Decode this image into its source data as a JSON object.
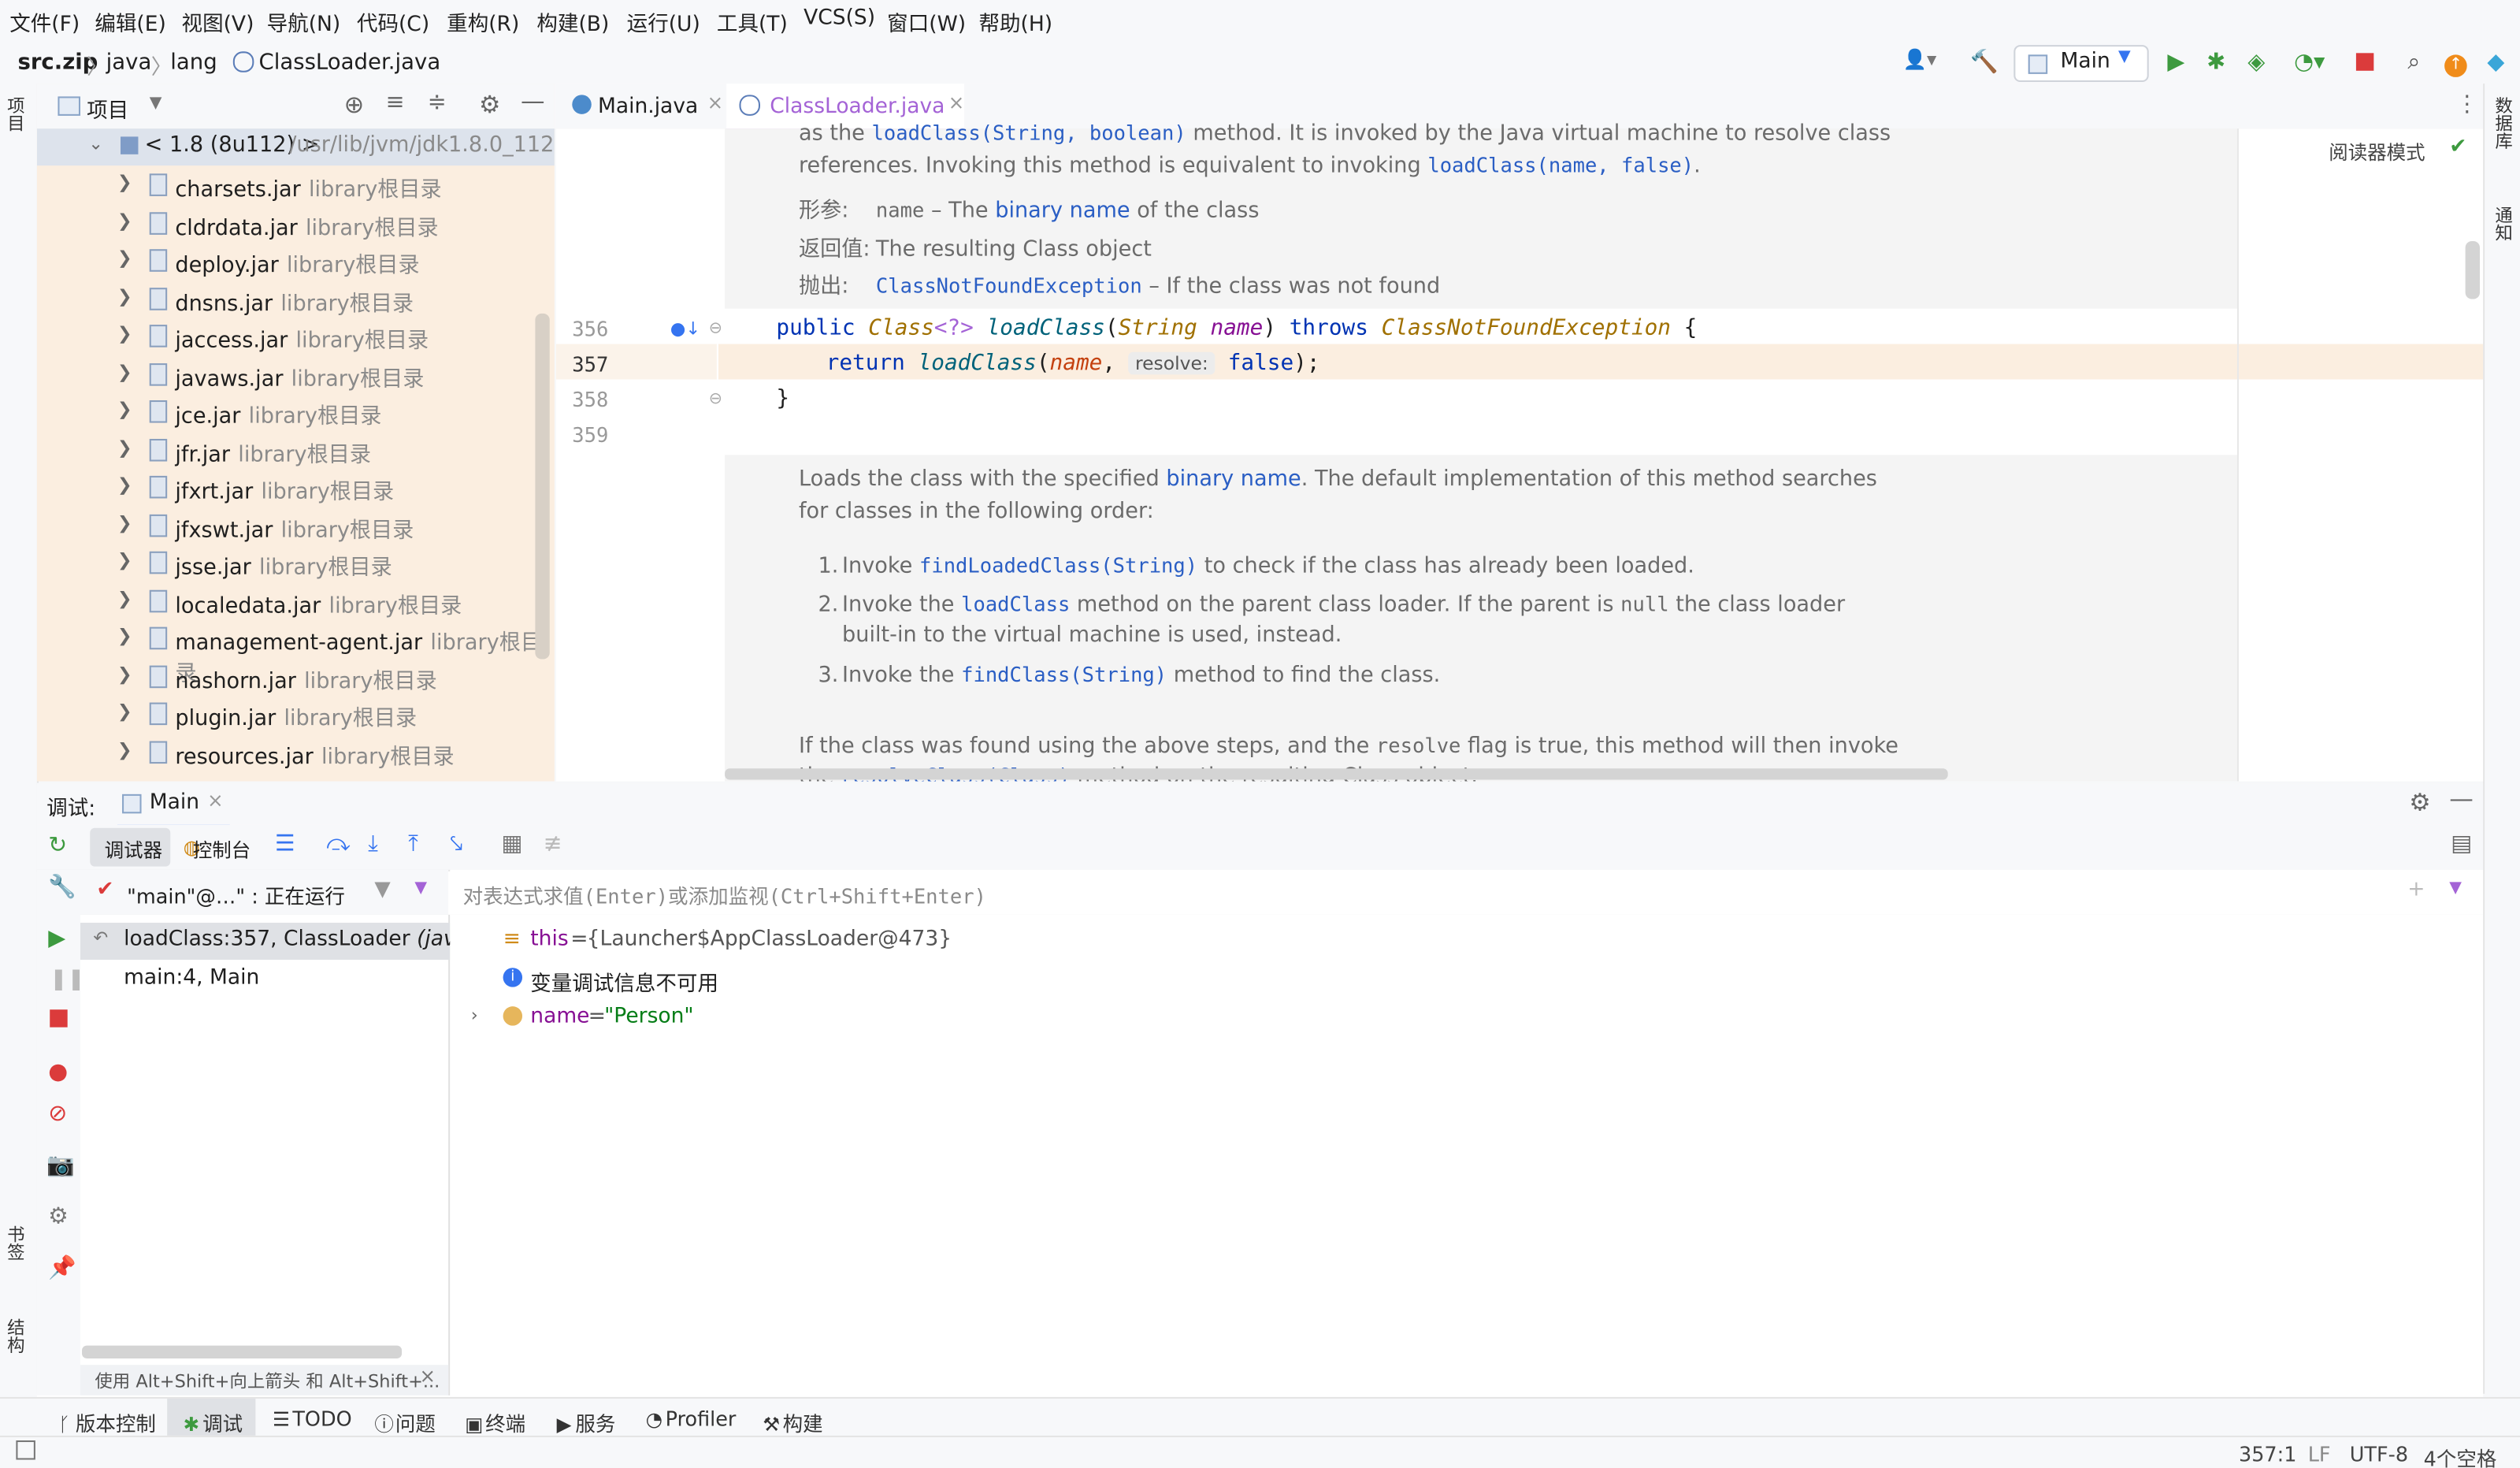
{
  "menu": [
    "文件(F)",
    "编辑(E)",
    "视图(V)",
    "导航(N)",
    "代码(C)",
    "重构(R)",
    "构建(B)",
    "运行(U)",
    "工具(T)",
    "VCS(S)",
    "窗口(W)",
    "帮助(H)"
  ],
  "breadcrumb": [
    "src.zip",
    "java",
    "lang",
    "ClassLoader.java"
  ],
  "run_config": "Main",
  "left_toolwindows": {
    "project": "项目",
    "bookmarks": "书签",
    "structure": "结构"
  },
  "right_toolwindows": {
    "database": "数据库",
    "notifications": "通知"
  },
  "project_panel": {
    "title": "项目",
    "root": {
      "label": "< 1.8 (8u112) >",
      "path": "/usr/lib/jvm/jdk1.8.0_112"
    },
    "library_suffix": "library根目录",
    "items": [
      "charsets.jar",
      "cldrdata.jar",
      "deploy.jar",
      "dnsns.jar",
      "jaccess.jar",
      "javaws.jar",
      "jce.jar",
      "jfr.jar",
      "jfxrt.jar",
      "jfxswt.jar",
      "jsse.jar",
      "localedata.jar",
      "management-agent.jar",
      "nashorn.jar",
      "plugin.jar",
      "resources.jar"
    ]
  },
  "editor": {
    "tabs": [
      {
        "label": "Main.java",
        "active": false
      },
      {
        "label": "ClassLoader.java",
        "active": true
      }
    ],
    "reader_mode": "阅读器模式",
    "doc_top": {
      "line1_pre": "as the ",
      "line1_code": "loadClass(String, boolean)",
      "line1_post": " method. It is invoked by the Java virtual machine to resolve class",
      "line2_pre": "references. Invoking this method is equivalent to invoking ",
      "line2_code": "loadClass(name, false)",
      "line2_post": ".",
      "param_label": "形参:",
      "param_name": "name",
      "param_dash": " – The ",
      "param_link": "binary name",
      "param_post": " of the class",
      "return_label": "返回值:",
      "return_text": "The resulting Class object",
      "throws_label": "抛出:",
      "throws_code": "ClassNotFoundException",
      "throws_post": " – If the class was not found"
    },
    "line_numbers": [
      "356",
      "357",
      "358",
      "359"
    ],
    "code": {
      "l356": {
        "kw1": "public ",
        "ty1": "Class",
        "ty2": "<?> ",
        "fn": "loadClass",
        "p1": "(",
        "ty3": "String ",
        "nm": "name",
        "p2": ") ",
        "kw2": "throws ",
        "ty4": "ClassNotFoundException",
        "p3": " {"
      },
      "l357": {
        "kw1": "return ",
        "fn": "loadClass",
        "p1": "(",
        "nm": "name",
        "p2": ", ",
        "hint": "resolve:",
        "kw2": " false",
        "p3": ");"
      },
      "l358": "}"
    },
    "doc_bottom": {
      "p1_pre": "Loads the class with the specified ",
      "p1_link": "binary name",
      "p1_post": ". The default implementation of this method searches",
      "p1_line2": "for classes in the following order:",
      "li1_num": "1.",
      "li1_pre": "Invoke ",
      "li1_code": "findLoadedClass(String)",
      "li1_post": " to check if the class has already been loaded.",
      "li2_num": "2.",
      "li2_pre": "Invoke the ",
      "li2_code": "loadClass",
      "li2_mid": " method on the parent class loader. If the parent is ",
      "li2_null": "null",
      "li2_post": " the class loader",
      "li2_line2": "built-in to the virtual machine is used, instead.",
      "li3_num": "3.",
      "li3_pre": "Invoke the ",
      "li3_code": "findClass(String)",
      "li3_post": " method to find the class.",
      "p2_pre": "If the class was found using the above steps, and the ",
      "p2_code": "resolve",
      "p2_post": " flag is true, this method will then invoke",
      "p2_line2_pre": "the ",
      "p2_line2_code": "resolveClass(Class)",
      "p2_line2_post": " method on the resulting Class object."
    }
  },
  "debug": {
    "label": "调试:",
    "session_tab": "Main",
    "tabs": {
      "debugger": "调试器",
      "console": "控制台"
    },
    "thread": "\"main\"@…\" : 正在运行",
    "eval_placeholder": "对表达式求值(Enter)或添加监视(Ctrl+Shift+Enter)",
    "frames": [
      {
        "method": "loadClass:357, ClassLoader",
        "pkg": "(java.lang)"
      },
      {
        "method": "main:4, Main",
        "pkg": ""
      }
    ],
    "hint": "使用 Alt+Shift+向上箭头 和 Alt+Shift+...",
    "variables": [
      {
        "name": "this",
        "value": "{Launcher$AppClassLoader@473}"
      },
      {
        "name": "",
        "value": "变量调试信息不可用"
      },
      {
        "name": "name",
        "value": "\"Person\""
      }
    ]
  },
  "bottom_tabs": [
    "版本控制",
    "调试",
    "TODO",
    "问题",
    "终端",
    "服务",
    "Profiler",
    "构建"
  ],
  "status": {
    "position": "357:1",
    "line_sep": "LF",
    "encoding": "UTF-8",
    "indent": "4个空格"
  },
  "colors": {
    "accent": "#3574f0",
    "run_green": "#3d9a3f",
    "stop_red": "#db3b3b",
    "project_bg": "#fbeee0",
    "current_line": "#fbeee0"
  }
}
